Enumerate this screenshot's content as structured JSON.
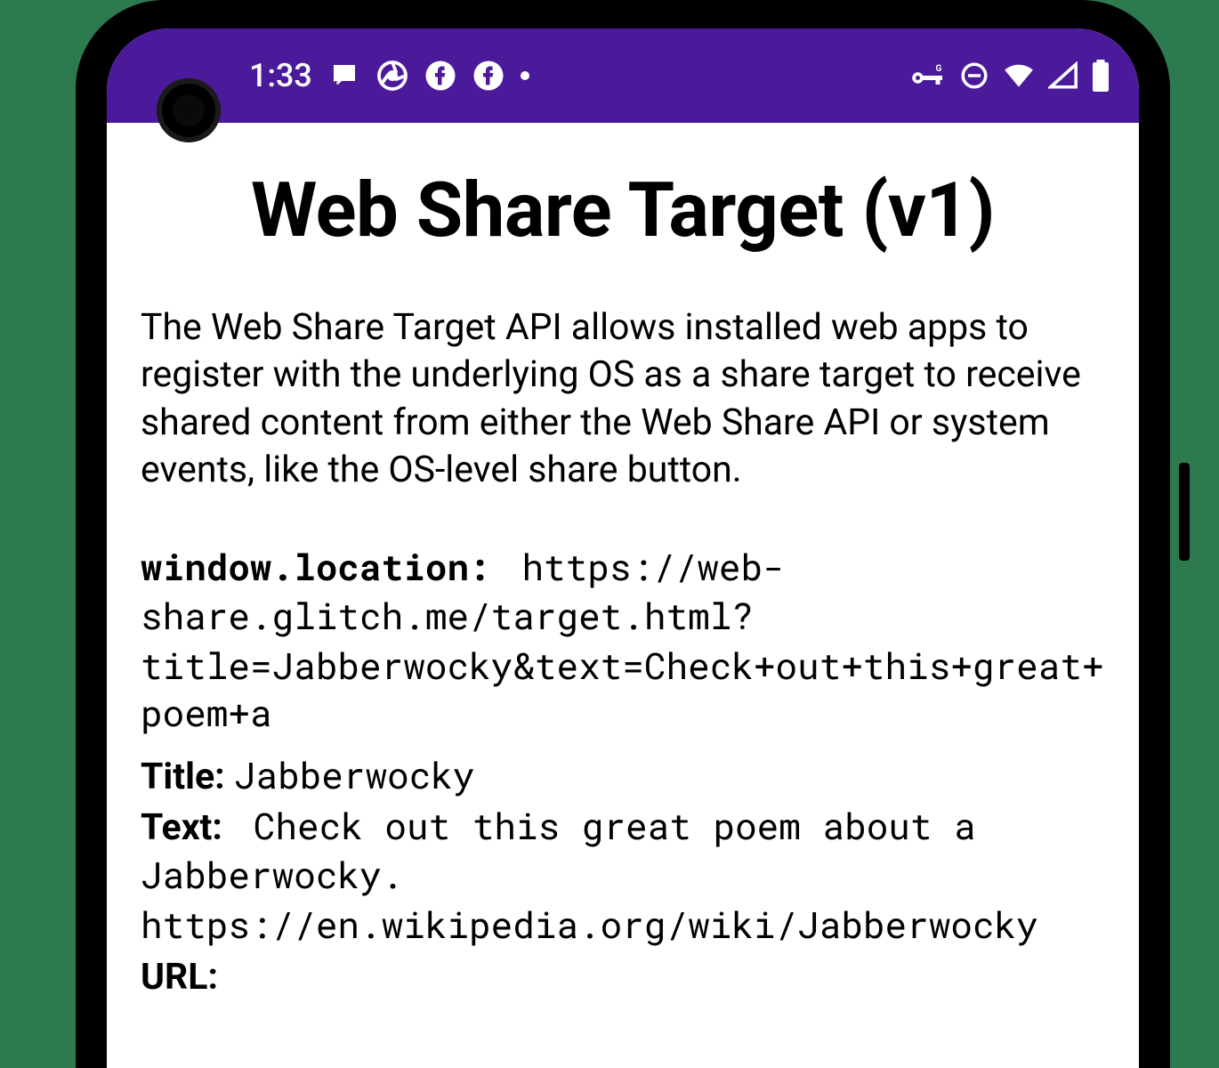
{
  "status_bar": {
    "time": "1:33",
    "colors": {
      "background": "#4b1a9b",
      "foreground": "#ffffff"
    }
  },
  "page": {
    "title": "Web Share Target (v1)",
    "description": "The Web Share Target API allows installed web apps to register with the underlying OS as a share target to receive shared content from either the Web Share API or system events, like the OS-level share button.",
    "fields": {
      "location_label": "window.location:",
      "location_value": "https://web-share.glitch.me/target.html?title=Jabberwocky&text=Check+out+this+great+poem+a",
      "title_label": "Title:",
      "title_value": "Jabberwocky",
      "text_label": "Text:",
      "text_value": "Check out this great poem about a Jabberwocky. https://en.wikipedia.org/wiki/Jabberwocky",
      "url_label": "URL:",
      "url_value": ""
    }
  }
}
